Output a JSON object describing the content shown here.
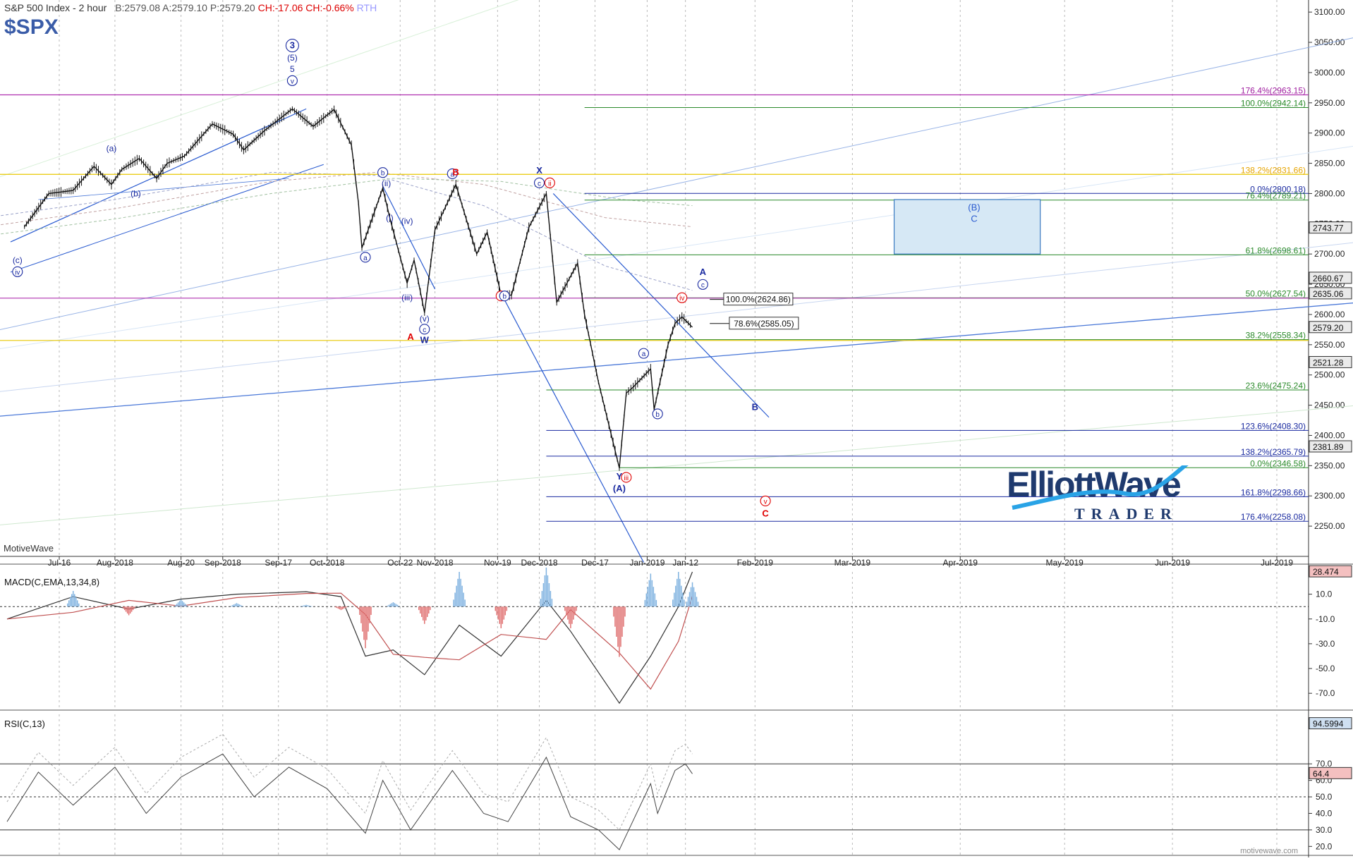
{
  "header": {
    "title": "S&P 500 Index - 2 hour",
    "quote": "B:2579.08 A:2579.10 P:2579.20",
    "change": "CH:-17.06 CH:-0.66%",
    "session": "RTH",
    "symbol": "$SPX",
    "provider": "MotiveWave",
    "watermark": "motivewave.com"
  },
  "colors": {
    "price": "#111111",
    "blue_line": "#2255cc",
    "purple_line": "#b030b0",
    "yellow_line": "#e8c800",
    "green_line": "#2a8a2a",
    "navy_line": "#1a2aa0",
    "fib_gold": "#e6a400",
    "red_label": "#e00000",
    "box_fill": "#d6e8f5",
    "macd_up": "#7fb2e0",
    "macd_down": "#e07070",
    "brand": "#1f3a6e",
    "brand_accent": "#29a3e6"
  },
  "logo": {
    "line1": "ElliottWave",
    "line2": "TRADER"
  },
  "chart_data": [
    {
      "type": "line",
      "title": "S&P 500 Index - 2 hour",
      "y_axis_ticks": [
        "3100.00",
        "3050.00",
        "3000.00",
        "2950.00",
        "2900.00",
        "2850.00",
        "2800.00",
        "2750.00",
        "2700.00",
        "2650.00",
        "2600.00",
        "2550.00",
        "2500.00",
        "2450.00",
        "2400.00",
        "2350.00",
        "2300.00",
        "2250.00"
      ],
      "x_axis_ticks": [
        "Jul-16",
        "Aug-2018",
        "Aug-20",
        "Sep-2018",
        "Sep-17",
        "Oct-2018",
        "Oct-22",
        "Nov-2018",
        "Nov-19",
        "Dec-2018",
        "Dec-17",
        "Jan-2019",
        "Jan-12",
        "Feb-2019",
        "Mar-2019",
        "Apr-2019",
        "May-2019",
        "Jun-2019",
        "Jul-2019"
      ],
      "ylim": [
        2200,
        3120
      ],
      "price_tags": [
        "2743.77",
        "2660.67",
        "2635.06",
        "2579.20",
        "2521.28",
        "2381.89"
      ],
      "price_path": [
        [
          "2018-07-06",
          2745
        ],
        [
          "2018-07-13",
          2800
        ],
        [
          "2018-07-20",
          2805
        ],
        [
          "2018-07-26",
          2845
        ],
        [
          "2018-07-31",
          2815
        ],
        [
          "2018-08-03",
          2840
        ],
        [
          "2018-08-08",
          2858
        ],
        [
          "2018-08-13",
          2825
        ],
        [
          "2018-08-16",
          2850
        ],
        [
          "2018-08-21",
          2862
        ],
        [
          "2018-08-29",
          2915
        ],
        [
          "2018-09-04",
          2898
        ],
        [
          "2018-09-07",
          2872
        ],
        [
          "2018-09-13",
          2904
        ],
        [
          "2018-09-21",
          2940
        ],
        [
          "2018-09-27",
          2911
        ],
        [
          "2018-10-03",
          2939
        ],
        [
          "2018-10-08",
          2880
        ],
        [
          "2018-10-10",
          2785
        ],
        [
          "2018-10-11",
          2710
        ],
        [
          "2018-10-17",
          2809
        ],
        [
          "2018-10-19",
          2760
        ],
        [
          "2018-10-24",
          2652
        ],
        [
          "2018-10-26",
          2690
        ],
        [
          "2018-10-29",
          2603
        ],
        [
          "2018-11-01",
          2740
        ],
        [
          "2018-11-07",
          2815
        ],
        [
          "2018-11-13",
          2700
        ],
        [
          "2018-11-16",
          2736
        ],
        [
          "2018-11-20",
          2632
        ],
        [
          "2018-11-23",
          2632
        ],
        [
          "2018-11-28",
          2744
        ],
        [
          "2018-12-03",
          2800
        ],
        [
          "2018-12-06",
          2620
        ],
        [
          "2018-12-12",
          2685
        ],
        [
          "2018-12-14",
          2600
        ],
        [
          "2018-12-18",
          2488
        ],
        [
          "2018-12-24",
          2346
        ],
        [
          "2018-12-26",
          2470
        ],
        [
          "2018-12-28",
          2480
        ],
        [
          "2019-01-02",
          2510
        ],
        [
          "2019-01-03",
          2443
        ],
        [
          "2019-01-07",
          2550
        ],
        [
          "2019-01-09",
          2585
        ],
        [
          "2019-01-11",
          2596
        ],
        [
          "2019-01-14",
          2579
        ]
      ],
      "annotations": [
        {
          "text": "3",
          "wave": "circled-blue",
          "date": "2018-09-21",
          "price": 3040
        },
        {
          "text": "(5)",
          "wave": "blue",
          "date": "2018-09-21",
          "price": 3020
        },
        {
          "text": "5",
          "wave": "blue",
          "date": "2018-09-21",
          "price": 3001
        },
        {
          "text": "v",
          "wave": "circled-blue-small",
          "date": "2018-09-21",
          "price": 2982
        },
        {
          "text": "(a)",
          "wave": "blue",
          "date": "2018-07-31",
          "price": 2870
        },
        {
          "text": "(b)",
          "wave": "blue",
          "date": "2018-08-07",
          "price": 2795
        },
        {
          "text": "(c)",
          "wave": "blue",
          "date": "2018-07-04",
          "price": 2685
        },
        {
          "text": "iv",
          "wave": "circled-blue-small",
          "date": "2018-07-04",
          "price": 2666
        },
        {
          "text": "b",
          "wave": "circled-blue-small",
          "date": "2018-10-17",
          "price": 2830
        },
        {
          "text": "(ii)",
          "wave": "blue",
          "date": "2018-10-18",
          "price": 2812
        },
        {
          "text": "a",
          "wave": "circled-blue-small",
          "date": "2018-10-12",
          "price": 2690
        },
        {
          "text": "(i)",
          "wave": "blue",
          "date": "2018-10-19",
          "price": 2755
        },
        {
          "text": "(iv)",
          "wave": "blue",
          "date": "2018-10-24",
          "price": 2750
        },
        {
          "text": "(iii)",
          "wave": "blue",
          "date": "2018-10-24",
          "price": 2623
        },
        {
          "text": "(v)",
          "wave": "blue",
          "date": "2018-10-29",
          "price": 2588
        },
        {
          "text": "c",
          "wave": "circled-blue-small",
          "date": "2018-10-29",
          "price": 2571
        },
        {
          "text": "W",
          "wave": "navy-bold",
          "date": "2018-10-29",
          "price": 2553
        },
        {
          "text": "A",
          "wave": "red-bold",
          "date": "2018-10-25",
          "price": 2558
        },
        {
          "text": "a",
          "wave": "circled-blue-small",
          "date": "2018-11-06",
          "price": 2828
        },
        {
          "text": "B",
          "wave": "red-bold",
          "date": "2018-11-07",
          "price": 2830
        },
        {
          "text": "i",
          "wave": "circled-red-small",
          "date": "2018-11-20",
          "price": 2626
        },
        {
          "text": "b",
          "wave": "circled-blue-small",
          "date": "2018-11-21",
          "price": 2626
        },
        {
          "text": "X",
          "wave": "navy-bold",
          "date": "2018-12-01",
          "price": 2833
        },
        {
          "text": "c",
          "wave": "circled-blue-small",
          "date": "2018-12-01",
          "price": 2813
        },
        {
          "text": "ii",
          "wave": "circled-red-small",
          "date": "2018-12-04",
          "price": 2813
        },
        {
          "text": "Y",
          "wave": "navy-bold",
          "date": "2018-12-24",
          "price": 2327
        },
        {
          "text": "(A)",
          "wave": "navy-bold",
          "date": "2018-12-24",
          "price": 2307
        },
        {
          "text": "iii",
          "wave": "circled-red-small",
          "date": "2018-12-26",
          "price": 2326
        },
        {
          "text": "a",
          "wave": "circled-blue-small",
          "date": "2018-12-31",
          "price": 2531
        },
        {
          "text": "b",
          "wave": "circled-blue-small",
          "date": "2019-01-04",
          "price": 2431
        },
        {
          "text": "iv",
          "wave": "circled-red-small",
          "date": "2019-01-11",
          "price": 2623
        },
        {
          "text": "A",
          "wave": "navy-bold",
          "date": "2019-01-17",
          "price": 2665
        },
        {
          "text": "c",
          "wave": "circled-blue-small",
          "date": "2019-01-17",
          "price": 2645
        },
        {
          "text": "B",
          "wave": "navy-bold",
          "date": "2019-02-01",
          "price": 2442
        },
        {
          "text": "v",
          "wave": "circled-red-small",
          "date": "2019-02-04",
          "price": 2287
        },
        {
          "text": "C",
          "wave": "red-bold",
          "date": "2019-02-04",
          "price": 2266
        },
        {
          "text": "(B)",
          "wave": "box",
          "date": "2019-04-05",
          "price": 2772
        },
        {
          "text": "C",
          "wave": "box",
          "date": "2019-04-05",
          "price": 2753
        }
      ],
      "fib_levels": [
        {
          "text": "176.4%(2963.15)",
          "value": 2963.15,
          "color": "purple",
          "from": "2018-07-06",
          "line": true
        },
        {
          "text": "100.0%(2942.14)",
          "value": 2942.14,
          "color": "green",
          "from": "2018-12-14"
        },
        {
          "text": "138.2%(2831.66)",
          "value": 2831.66,
          "color": "gold",
          "from": "2018-07-06",
          "line": true
        },
        {
          "text": "0.0%(2800.18)",
          "value": 2800.18,
          "color": "navy",
          "from": "2018-12-14"
        },
        {
          "text": "76.4%(2789.21)",
          "value": 2789.21,
          "color": "green",
          "from": "2018-12-14"
        },
        {
          "text": "61.8%(2698.61)",
          "value": 2698.61,
          "color": "green",
          "from": "2018-12-14"
        },
        {
          "text": "50.0%(2627.54)",
          "value": 2627.54,
          "color": "green",
          "from": "2018-12-14"
        },
        {
          "text": "38.2%(2558.34)",
          "value": 2558.34,
          "color": "green",
          "from": "2018-12-14"
        },
        {
          "text": "23.6%(2475.24)",
          "value": 2475.24,
          "color": "green",
          "from": "2018-12-03"
        },
        {
          "text": "123.6%(2408.30)",
          "value": 2408.3,
          "color": "navy",
          "from": "2018-12-03"
        },
        {
          "text": "138.2%(2365.79)",
          "value": 2365.79,
          "color": "navy",
          "from": "2018-12-03"
        },
        {
          "text": "0.0%(2346.58)",
          "value": 2346.58,
          "color": "green",
          "from": "2018-12-24"
        },
        {
          "text": "161.8%(2298.66)",
          "value": 2298.66,
          "color": "navy",
          "from": "2018-12-03"
        },
        {
          "text": "176.4%(2258.08)",
          "value": 2258.08,
          "color": "navy",
          "from": "2018-12-03"
        }
      ],
      "boxed_levels": [
        {
          "text": "100.0%(2624.86)",
          "value": 2624.86
        },
        {
          "text": "78.6%(2585.05)",
          "value": 2585.05
        }
      ],
      "box": {
        "from": "2019-03-13",
        "to": "2019-04-24",
        "top": 2790,
        "bottom": 2700
      }
    },
    {
      "type": "line",
      "title": "MACD(C,EMA,13,34,8)",
      "y_axis_ticks": [
        "10.0",
        "-10.0",
        "-30.0",
        "-50.0",
        "-70.0"
      ],
      "ylim": [
        -83,
        28
      ],
      "value_tag": "28.474"
    },
    {
      "type": "line",
      "title": "RSI(C,13)",
      "y_axis_ticks": [
        "70.0",
        "60.0",
        "50.0",
        "40.0",
        "30.0",
        "20.0"
      ],
      "ylim": [
        15,
        100
      ],
      "value_tags": [
        "94.5994",
        "64.4"
      ],
      "levels": [
        70,
        50,
        30
      ]
    }
  ]
}
